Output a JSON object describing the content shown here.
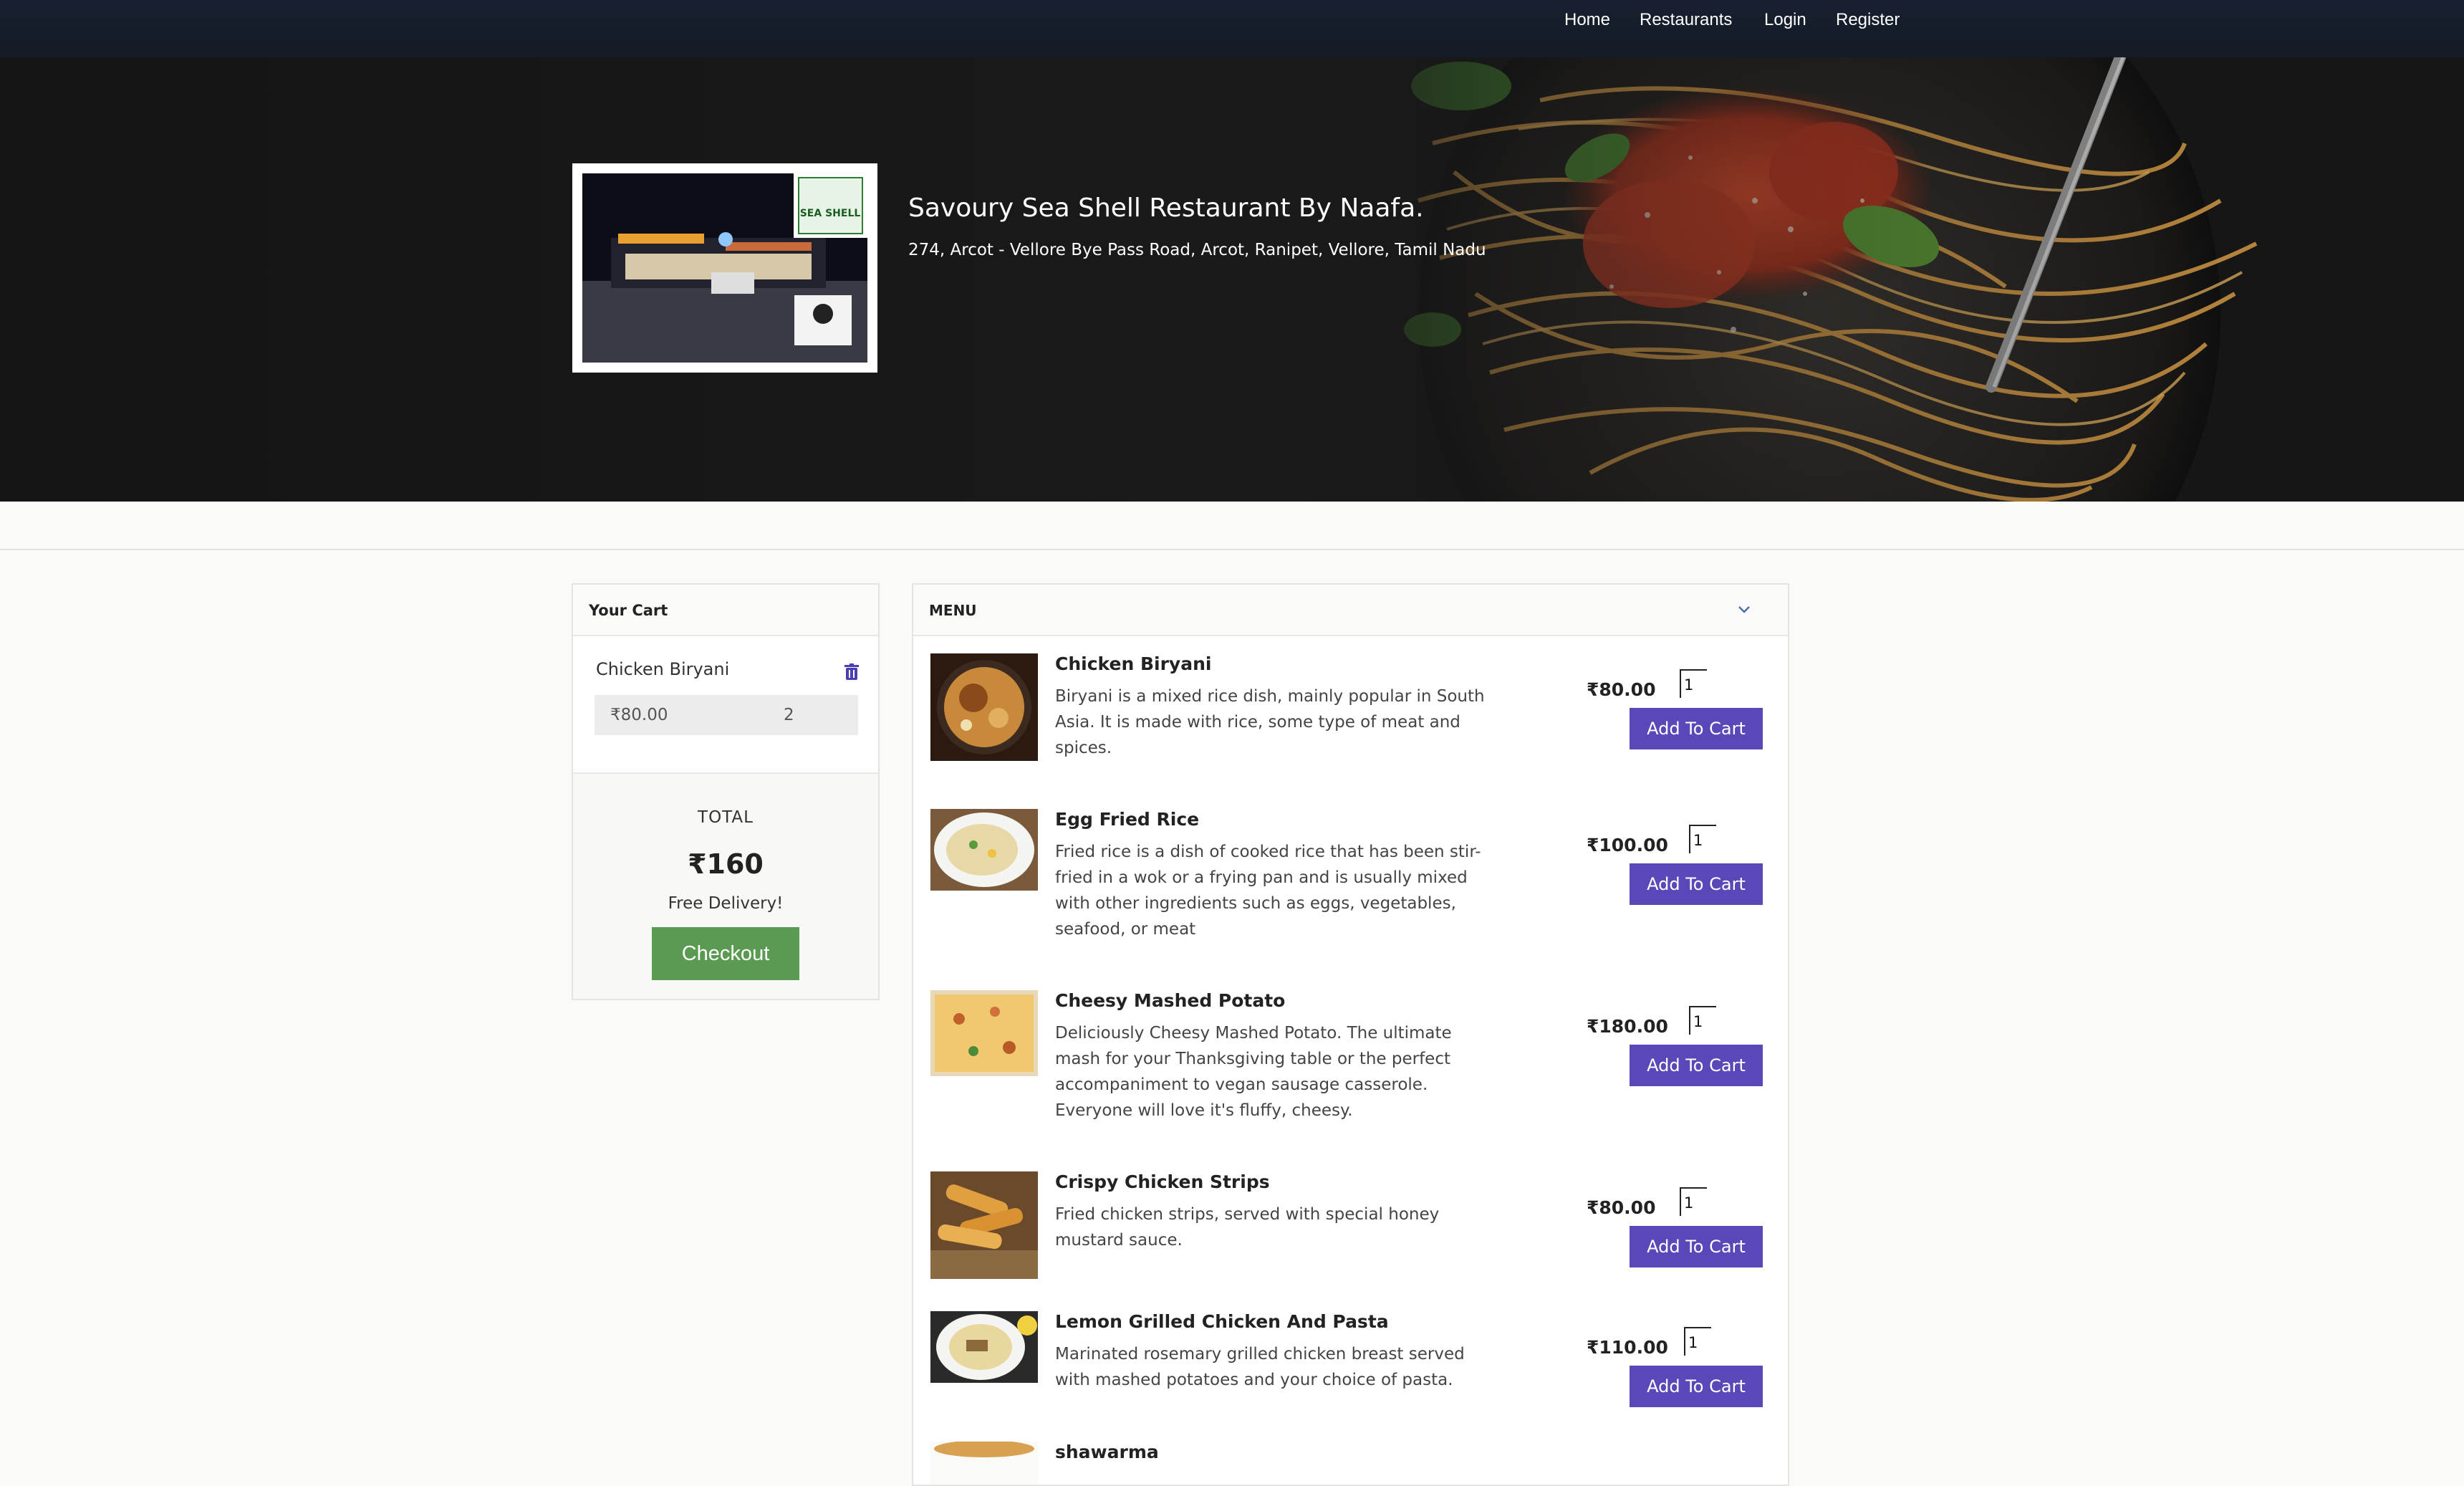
{
  "nav": {
    "links": [
      "Home",
      "Restaurants",
      "Login",
      "Register"
    ]
  },
  "restaurant": {
    "name": "Savoury Sea Shell Restaurant By Naafa.",
    "address": "274, Arcot - Vellore Bye Pass Road, Arcot, Ranipet, Vellore, Tamil Nadu",
    "logo_text": "SEA SHELL"
  },
  "cart": {
    "title": "Your Cart",
    "items": [
      {
        "name": "Chicken Biryani",
        "price": "₹80.00",
        "qty": "2"
      }
    ],
    "total_label": "TOTAL",
    "total_value": "₹160",
    "delivery_note": "Free Delivery!",
    "checkout_label": "Checkout",
    "accent_color": "#5b9a52"
  },
  "menu": {
    "title": "MENU",
    "add_label": "Add To Cart",
    "button_color": "#5a47b8",
    "items": [
      {
        "name": "Chicken Biryani",
        "description": "Biryani is a mixed rice dish, mainly popular in South Asia. It is made with rice, some type of meat and spices.",
        "price": "₹80.00",
        "qty": "1"
      },
      {
        "name": "Egg Fried Rice",
        "description": "Fried rice is a dish of cooked rice that has been stir-fried in a wok or a frying pan and is usually mixed with other ingredients such as eggs, vegetables, seafood, or meat",
        "price": "₹100.00",
        "qty": "1"
      },
      {
        "name": "Cheesy Mashed Potato",
        "description": "Deliciously Cheesy Mashed Potato. The ultimate mash for your Thanksgiving table or the perfect accompaniment to vegan sausage casserole. Everyone will love it's fluffy, cheesy.",
        "price": "₹180.00",
        "qty": "1"
      },
      {
        "name": "Crispy Chicken Strips",
        "description": "Fried chicken strips, served with special honey mustard sauce.",
        "price": "₹80.00",
        "qty": "1"
      },
      {
        "name": "Lemon Grilled Chicken And Pasta",
        "description": "Marinated rosemary grilled chicken breast served with mashed potatoes and your choice of pasta.",
        "price": "₹110.00",
        "qty": "1"
      },
      {
        "name": "shawarma",
        "description": "",
        "price": "",
        "qty": ""
      }
    ]
  }
}
